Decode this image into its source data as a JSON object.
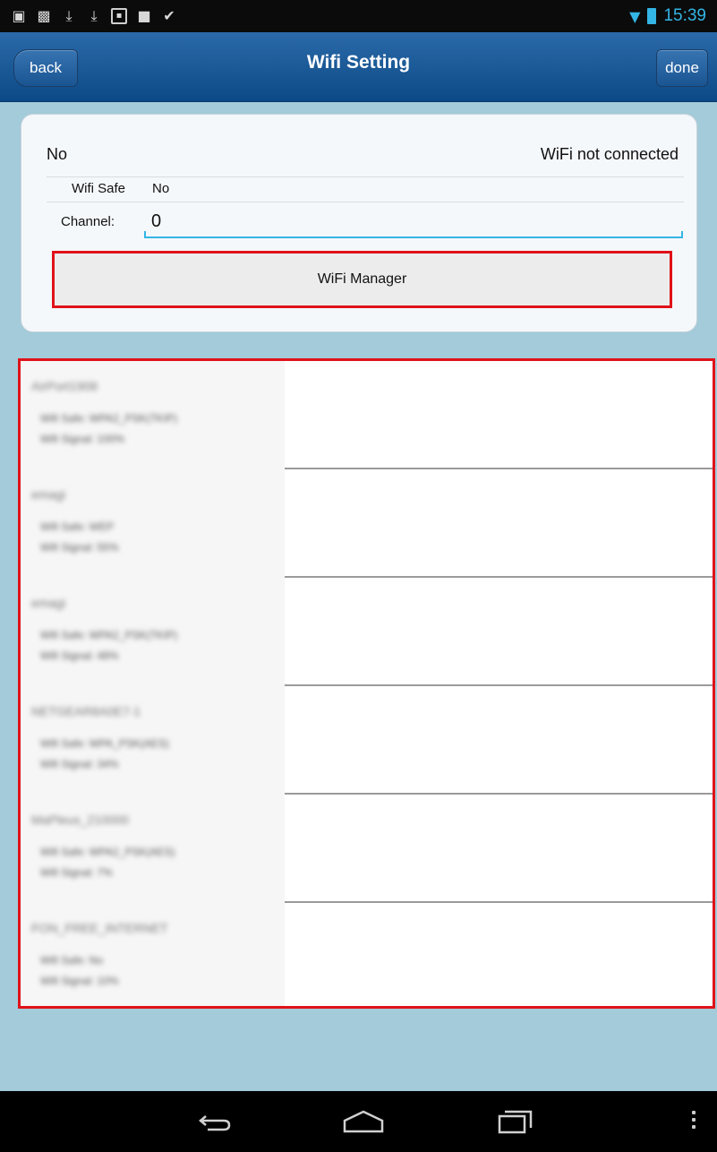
{
  "status_bar": {
    "clock": "15:39",
    "left_icons": [
      "gallery-icon",
      "photo-icon",
      "download-icon",
      "download-icon",
      "sd-card-icon",
      "briefcase-icon",
      "briefcase-check-icon"
    ],
    "right_icons": [
      "wifi-icon",
      "battery-icon"
    ],
    "accent_color": "#33b5e5"
  },
  "nav": {
    "back_label": "back",
    "title": "Wifi Setting",
    "done_label": "done"
  },
  "card": {
    "ssid_value": "No",
    "status_text": "WiFi not connected",
    "safe_label": "Wifi Safe",
    "safe_value": "No",
    "channel_label": "Channel:",
    "channel_value": "0",
    "manager_button": "WiFi Manager"
  },
  "wifi_list": [
    {
      "name": "AirPort1908",
      "safe": "Wifi Safe: WPA2_PSK(TKIP)",
      "signal": "Wifi Signal: 100%"
    },
    {
      "name": "emagi",
      "safe": "Wifi Safe: WEP",
      "signal": "Wifi Signal: 55%"
    },
    {
      "name": "emagi",
      "safe": "Wifi Safe: WPA2_PSK(TKIP)",
      "signal": "Wifi Signal: 48%"
    },
    {
      "name": "NETGEAR8A0E7-1",
      "safe": "Wifi Safe: WPA_PSK(AES)",
      "signal": "Wifi Signal: 34%"
    },
    {
      "name": "MaPleus_210000",
      "safe": "Wifi Safe: WPA2_PSK(AES)",
      "signal": "Wifi Signal: 7%"
    },
    {
      "name": "FON_FREE_INTERNET",
      "safe": "Wifi Safe: No",
      "signal": "Wifi Signal: 10%"
    }
  ],
  "bottom_nav": {
    "icons": [
      "back-icon",
      "home-icon",
      "recent-apps-icon",
      "menu-icon"
    ]
  },
  "colors": {
    "nav_blue": "#0c4986",
    "page_bg": "#a3cbd9",
    "highlight_red": "#e0121a"
  }
}
